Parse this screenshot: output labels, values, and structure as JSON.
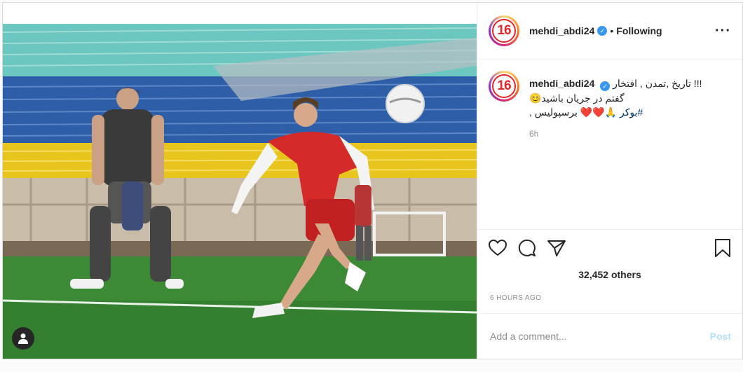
{
  "post": {
    "author": {
      "username": "mehdi_abdi24",
      "verified": true,
      "avatar_text": "16",
      "follow_status": "Following",
      "separator": "•"
    },
    "caption": {
      "username": "mehdi_abdi24",
      "line1": "!!! تاریخ ,تمدن , افتخار",
      "line2": "گفتم در جریان باشید😊",
      "line3_text": "🙏❤️❤️ برسپولیس ,",
      "hashtag": "#بوکر",
      "time": "6h"
    },
    "likes_text": "32,452 others",
    "time_ago": "6 HOURS AGO",
    "comment_box": {
      "placeholder": "Add a comment...",
      "post_label": "Post"
    },
    "icons": {
      "like": "heart-icon",
      "comment": "comment-icon",
      "share": "share-icon",
      "save": "bookmark-icon",
      "more": "more-options-icon",
      "user_tag": "user-tag-icon"
    },
    "colors": {
      "link": "#00376b",
      "verified": "#3897f0",
      "post_disabled": "#b2dffc",
      "jersey": "#d42a2a"
    }
  }
}
